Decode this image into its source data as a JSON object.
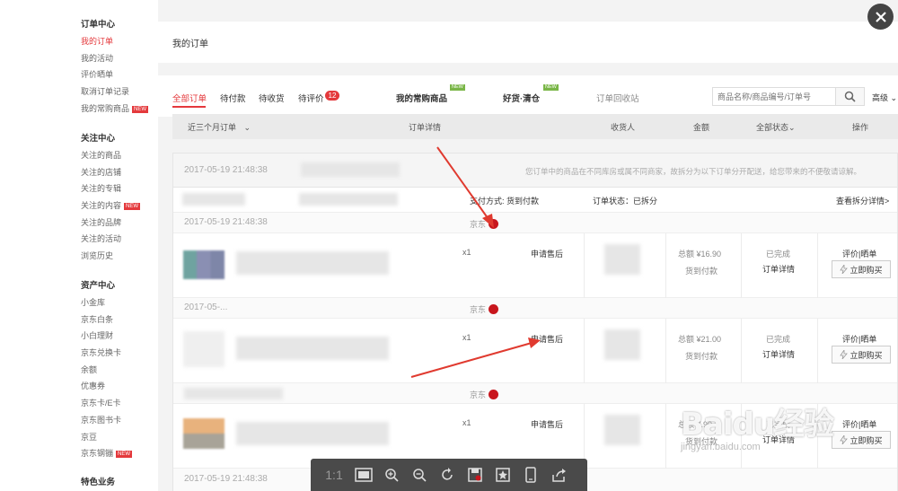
{
  "sidebar": {
    "groups": [
      {
        "title": "订单中心",
        "items": [
          "我的订单",
          "我的活动",
          "评价晒单",
          "取消订单记录",
          "我的常购商品"
        ]
      },
      {
        "title": "关注中心",
        "items": [
          "关注的商品",
          "关注的店铺",
          "关注的专辑",
          "关注的内容",
          "关注的品牌",
          "关注的活动",
          "浏览历史"
        ]
      },
      {
        "title": "资产中心",
        "items": [
          "小金库",
          "京东白条",
          "小白理财",
          "京东兑换卡",
          "余额",
          "优惠券",
          "京东卡/E卡",
          "京东图书卡",
          "京豆",
          "京东钢镚"
        ]
      },
      {
        "title": "特色业务",
        "items": []
      }
    ],
    "badge": "NEW"
  },
  "page_title": "我的订单",
  "tabs": {
    "all": "全部订单",
    "unpaid": "待付款",
    "unreceived": "待收货",
    "unrated": "待评价",
    "unrated_count": "12",
    "frequent": "我的常购商品",
    "clearance": "好货·清仓",
    "recycle": "订单回收站",
    "new_badge": "NEW"
  },
  "search": {
    "placeholder": "商品名称/商品编号/订单号",
    "advanced": "高级"
  },
  "columns": {
    "period": "近三个月订单",
    "details": "订单详情",
    "receiver": "收货人",
    "amount": "金额",
    "status": "全部状态",
    "actions": "操作"
  },
  "order_group": {
    "time": "2017-05-19 21:48:38",
    "notice": "您订单中的商品在不同库房或属不同商家，故拆分为以下订单分开配送，给您带来的不便敬请谅解。",
    "payment": "支付方式: 货到付款",
    "order_status": "订单状态：已拆分",
    "view_split": "查看拆分详情>"
  },
  "sub_orders": [
    {
      "time": "2017-05-19 21:48:38",
      "shop": "京东",
      "qty": "x1",
      "aftersale": "申请售后",
      "total": "总额 ¥16.90",
      "pay": "货到付款",
      "status": "已完成",
      "detail": "订单详情",
      "rate": "评价|晒单",
      "buy": "立即购买"
    },
    {
      "time": "2017-05-...",
      "shop": "京东",
      "qty": "x1",
      "aftersale": "申请售后",
      "total": "总额 ¥21.00",
      "pay": "货到付款",
      "status": "已完成",
      "detail": "订单详情",
      "rate": "评价|晒单",
      "buy": "立即购买"
    },
    {
      "time": "",
      "shop": "京东",
      "qty": "x1",
      "aftersale": "申请售后",
      "total": "总额 ¥.90",
      "pay": "货到付款",
      "status": "已完成",
      "detail": "订单详情",
      "rate": "评价|晒单",
      "buy": "立即购买"
    }
  ],
  "last_time": "2017-05-19 21:48:38",
  "viewer": {
    "ratio": "1:1"
  },
  "watermark": {
    "main": "Baidu经验",
    "sub": "jingyan.baidu.com"
  },
  "colors": {
    "accent": "#e4393c",
    "green_badge": "#7ab648",
    "toolbar": "#4a4a4a"
  }
}
